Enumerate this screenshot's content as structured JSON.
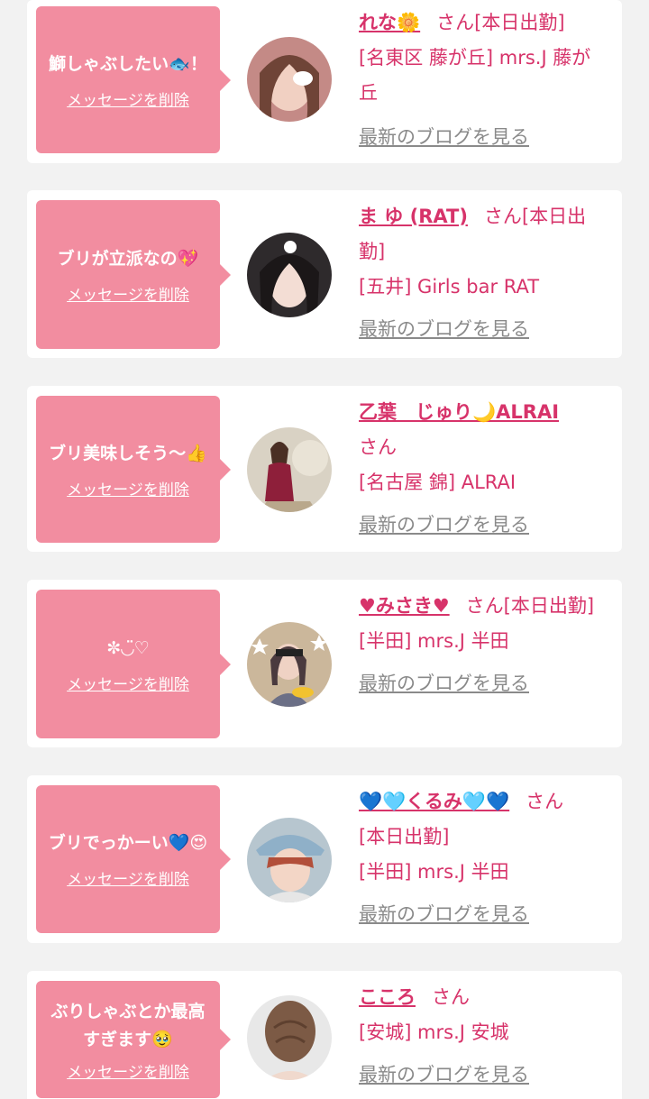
{
  "cards": [
    {
      "message": "鰤しゃぶしたい🐟！",
      "delete_label": "メッセージを削除",
      "name": "れな🌼",
      "suffix": "さん",
      "status": "[本日出勤]",
      "shop": "[名東区 藤が丘] mrs.J 藤が丘",
      "blog_label": "最新のブログを見る"
    },
    {
      "message": "ブリが立派なの💖",
      "delete_label": "メッセージを削除",
      "name": "ま ゆ (RAT)",
      "suffix": "さん",
      "status": "[本日出勤]",
      "shop": "[五井] Girls bar RAT",
      "blog_label": "最新のブログを見る"
    },
    {
      "message": "ブリ美味しそう〜👍",
      "delete_label": "メッセージを削除",
      "name": "乙葉　じゅり🌙ALRAI",
      "suffix": "さん",
      "status": "",
      "shop": "[名古屋 錦] ALRAI",
      "blog_label": "最新のブログを見る"
    },
    {
      "message": "✼◡̈♡",
      "delete_label": "メッセージを削除",
      "name": "♥みさき♥",
      "suffix": "さん",
      "status": "[本日出勤]",
      "shop": "[半田] mrs.J 半田",
      "blog_label": "最新のブログを見る"
    },
    {
      "message": "ブリでっかーい💙😍",
      "delete_label": "メッセージを削除",
      "name": "💙🩵くるみ🩵💙",
      "suffix": "さん",
      "status": "[本日出勤]",
      "shop": "[半田] mrs.J 半田",
      "blog_label": "最新のブログを見る"
    },
    {
      "message": "ぶりしゃぶとか最高すぎます🥹",
      "delete_label": "メッセージを削除",
      "name": "こころ",
      "suffix": "さん",
      "status": "",
      "shop": "[安城] mrs.J 安城",
      "blog_label": "最新のブログを見る"
    }
  ],
  "colors": {
    "bubble": "#f28da0",
    "accent": "#d7336a",
    "muted": "#8a8a8a",
    "background": "#f2f2f2"
  }
}
